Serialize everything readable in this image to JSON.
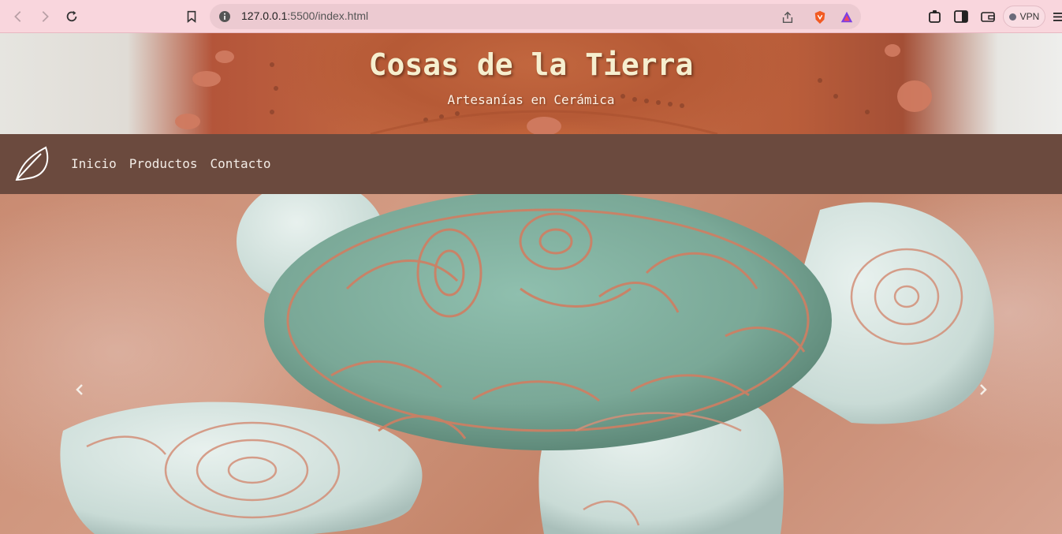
{
  "browser": {
    "url_host": "127.0.0.1",
    "url_rest": ":5500/index.html",
    "vpn_label": "VPN"
  },
  "header": {
    "title": "Cosas de la Tierra",
    "subtitle": "Artesanías en Cerámica"
  },
  "navbar": {
    "brand_icon": "leaf-icon",
    "links": [
      {
        "label": "Inicio"
      },
      {
        "label": "Productos"
      },
      {
        "label": "Contacto"
      }
    ]
  },
  "carousel": {
    "slide_description_icon": "ceramic-turtle-photo",
    "prev_icon": "chevron-left-icon",
    "next_icon": "chevron-right-icon"
  },
  "colors": {
    "browser_bar": "#f9d6dd",
    "navbar": "#6b4a3e",
    "title_text": "#f6efcf"
  }
}
